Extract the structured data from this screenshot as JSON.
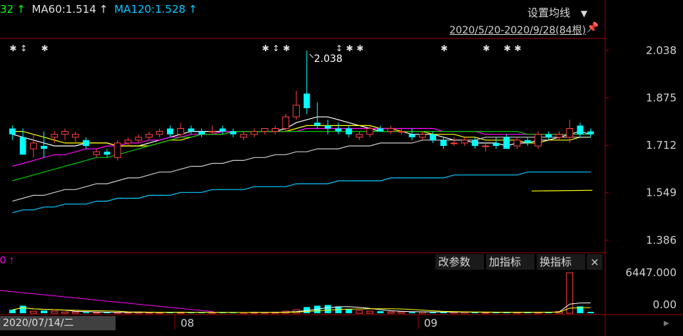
{
  "header": {
    "partial_value": "32",
    "ma60_label": "MA60:1.514",
    "ma120_label": "MA120:1.528",
    "set_ma_button": "设置均线",
    "period": "2020/5/20-2020/9/28(84根)"
  },
  "indicator_panel": {
    "partial_value": "0",
    "buttons": [
      "改参数",
      "加指标",
      "换指标"
    ],
    "close": "×"
  },
  "colors": {
    "up": "#ff4040",
    "down": "#00ffff",
    "ma5": "#ffffff",
    "ma10": "#ffff00",
    "ma20": "#ff00ff",
    "ma30": "#00c800",
    "ma60": "#c8c8c8",
    "ma120": "#00c8ff",
    "axis": "#a00000"
  },
  "chart_data": [
    {
      "type": "candlestick",
      "y_ticks": [
        "2.038",
        "1.875",
        "1.712",
        "1.549",
        "1.386"
      ],
      "ylim": [
        1.35,
        2.07
      ],
      "max_annotation": "2.038",
      "x_ticks": [
        "08",
        "09"
      ],
      "current_date": "2020/07/14/二",
      "candles": [
        {
          "o": 1.77,
          "h": 1.78,
          "l": 1.73,
          "c": 1.75
        },
        {
          "o": 1.74,
          "h": 1.77,
          "l": 1.68,
          "c": 1.68
        },
        {
          "o": 1.7,
          "h": 1.75,
          "l": 1.67,
          "c": 1.72
        },
        {
          "o": 1.71,
          "h": 1.76,
          "l": 1.67,
          "c": 1.7
        },
        {
          "o": 1.74,
          "h": 1.76,
          "l": 1.72,
          "c": 1.75
        },
        {
          "o": 1.75,
          "h": 1.77,
          "l": 1.73,
          "c": 1.76
        },
        {
          "o": 1.74,
          "h": 1.76,
          "l": 1.72,
          "c": 1.75
        },
        {
          "o": 1.73,
          "h": 1.74,
          "l": 1.7,
          "c": 1.71
        },
        {
          "o": 1.68,
          "h": 1.7,
          "l": 1.67,
          "c": 1.69
        },
        {
          "o": 1.69,
          "h": 1.7,
          "l": 1.67,
          "c": 1.68
        },
        {
          "o": 1.67,
          "h": 1.73,
          "l": 1.66,
          "c": 1.72
        },
        {
          "o": 1.72,
          "h": 1.74,
          "l": 1.71,
          "c": 1.73
        },
        {
          "o": 1.73,
          "h": 1.75,
          "l": 1.72,
          "c": 1.74
        },
        {
          "o": 1.74,
          "h": 1.76,
          "l": 1.73,
          "c": 1.75
        },
        {
          "o": 1.75,
          "h": 1.77,
          "l": 1.74,
          "c": 1.76
        },
        {
          "o": 1.77,
          "h": 1.78,
          "l": 1.74,
          "c": 1.75
        },
        {
          "o": 1.75,
          "h": 1.79,
          "l": 1.74,
          "c": 1.77
        },
        {
          "o": 1.77,
          "h": 1.78,
          "l": 1.75,
          "c": 1.76
        },
        {
          "o": 1.76,
          "h": 1.77,
          "l": 1.74,
          "c": 1.75
        },
        {
          "o": 1.76,
          "h": 1.78,
          "l": 1.75,
          "c": 1.76
        },
        {
          "o": 1.77,
          "h": 1.78,
          "l": 1.75,
          "c": 1.76
        },
        {
          "o": 1.76,
          "h": 1.77,
          "l": 1.74,
          "c": 1.75
        },
        {
          "o": 1.74,
          "h": 1.76,
          "l": 1.73,
          "c": 1.75
        },
        {
          "o": 1.75,
          "h": 1.77,
          "l": 1.74,
          "c": 1.76
        },
        {
          "o": 1.76,
          "h": 1.77,
          "l": 1.75,
          "c": 1.77
        },
        {
          "o": 1.76,
          "h": 1.78,
          "l": 1.75,
          "c": 1.77
        },
        {
          "o": 1.77,
          "h": 1.82,
          "l": 1.76,
          "c": 1.81
        },
        {
          "o": 1.81,
          "h": 1.9,
          "l": 1.8,
          "c": 1.85
        },
        {
          "o": 1.89,
          "h": 2.038,
          "l": 1.82,
          "c": 1.84
        },
        {
          "o": 1.79,
          "h": 1.86,
          "l": 1.77,
          "c": 1.78
        },
        {
          "o": 1.78,
          "h": 1.8,
          "l": 1.75,
          "c": 1.77
        },
        {
          "o": 1.77,
          "h": 1.79,
          "l": 1.75,
          "c": 1.76
        },
        {
          "o": 1.77,
          "h": 1.78,
          "l": 1.74,
          "c": 1.75
        },
        {
          "o": 1.74,
          "h": 1.76,
          "l": 1.73,
          "c": 1.75
        },
        {
          "o": 1.75,
          "h": 1.78,
          "l": 1.74,
          "c": 1.77
        },
        {
          "o": 1.77,
          "h": 1.78,
          "l": 1.76,
          "c": 1.76
        },
        {
          "o": 1.76,
          "h": 1.78,
          "l": 1.75,
          "c": 1.77
        },
        {
          "o": 1.76,
          "h": 1.77,
          "l": 1.75,
          "c": 1.76
        },
        {
          "o": 1.75,
          "h": 1.77,
          "l": 1.73,
          "c": 1.74
        },
        {
          "o": 1.74,
          "h": 1.76,
          "l": 1.73,
          "c": 1.75
        },
        {
          "o": 1.75,
          "h": 1.76,
          "l": 1.72,
          "c": 1.73
        },
        {
          "o": 1.73,
          "h": 1.74,
          "l": 1.7,
          "c": 1.71
        },
        {
          "o": 1.72,
          "h": 1.74,
          "l": 1.71,
          "c": 1.72
        },
        {
          "o": 1.72,
          "h": 1.74,
          "l": 1.71,
          "c": 1.73
        },
        {
          "o": 1.73,
          "h": 1.74,
          "l": 1.7,
          "c": 1.71
        },
        {
          "o": 1.71,
          "h": 1.72,
          "l": 1.69,
          "c": 1.71
        },
        {
          "o": 1.72,
          "h": 1.74,
          "l": 1.7,
          "c": 1.71
        },
        {
          "o": 1.74,
          "h": 1.75,
          "l": 1.7,
          "c": 1.7
        },
        {
          "o": 1.71,
          "h": 1.74,
          "l": 1.7,
          "c": 1.73
        },
        {
          "o": 1.73,
          "h": 1.74,
          "l": 1.71,
          "c": 1.72
        },
        {
          "o": 1.71,
          "h": 1.76,
          "l": 1.7,
          "c": 1.75
        },
        {
          "o": 1.75,
          "h": 1.76,
          "l": 1.73,
          "c": 1.74
        },
        {
          "o": 1.74,
          "h": 1.76,
          "l": 1.73,
          "c": 1.75
        },
        {
          "o": 1.74,
          "h": 1.8,
          "l": 1.72,
          "c": 1.77
        },
        {
          "o": 1.78,
          "h": 1.79,
          "l": 1.74,
          "c": 1.75
        },
        {
          "o": 1.76,
          "h": 1.77,
          "l": 1.74,
          "c": 1.75
        }
      ],
      "ma_lines": [
        {
          "name": "MA5",
          "values": [
            1.75,
            1.74,
            1.73,
            1.72,
            1.71,
            1.71,
            1.71,
            1.72,
            1.72,
            1.72,
            1.71,
            1.71,
            1.71,
            1.72,
            1.73,
            1.74,
            1.75,
            1.76,
            1.76,
            1.76,
            1.76,
            1.76,
            1.76,
            1.76,
            1.76,
            1.76,
            1.77,
            1.79,
            1.8,
            1.81,
            1.81,
            1.8,
            1.79,
            1.78,
            1.77,
            1.76,
            1.76,
            1.76,
            1.75,
            1.75,
            1.75,
            1.74,
            1.73,
            1.73,
            1.72,
            1.72,
            1.72,
            1.71,
            1.72,
            1.72,
            1.73,
            1.73,
            1.74,
            1.75,
            1.76,
            1.75
          ]
        },
        {
          "name": "MA10",
          "values": [
            1.76,
            1.76,
            1.75,
            1.74,
            1.73,
            1.72,
            1.72,
            1.72,
            1.72,
            1.72,
            1.71,
            1.71,
            1.71,
            1.71,
            1.72,
            1.73,
            1.73,
            1.74,
            1.75,
            1.75,
            1.75,
            1.76,
            1.76,
            1.76,
            1.76,
            1.76,
            1.76,
            1.77,
            1.78,
            1.78,
            1.78,
            1.78,
            1.78,
            1.78,
            1.78,
            1.77,
            1.77,
            1.76,
            1.76,
            1.76,
            1.75,
            1.75,
            1.75,
            1.74,
            1.74,
            1.73,
            1.73,
            1.73,
            1.73,
            1.72,
            1.72,
            1.73,
            1.73,
            1.73,
            1.74,
            1.74
          ]
        },
        {
          "name": "MA20",
          "values": [
            1.64,
            1.65,
            1.66,
            1.67,
            1.68,
            1.68,
            1.69,
            1.7,
            1.7,
            1.71,
            1.71,
            1.72,
            1.72,
            1.73,
            1.73,
            1.74,
            1.74,
            1.75,
            1.75,
            1.75,
            1.76,
            1.76,
            1.76,
            1.76,
            1.76,
            1.76,
            1.76,
            1.76,
            1.77,
            1.77,
            1.77,
            1.77,
            1.77,
            1.77,
            1.77,
            1.77,
            1.77,
            1.77,
            1.77,
            1.77,
            1.77,
            1.76,
            1.76,
            1.76,
            1.76,
            1.75,
            1.75,
            1.75,
            1.75,
            1.75,
            1.75,
            1.75,
            1.75,
            1.75,
            1.75,
            1.75
          ]
        },
        {
          "name": "MA30",
          "values": [
            1.59,
            1.6,
            1.61,
            1.62,
            1.63,
            1.64,
            1.65,
            1.66,
            1.67,
            1.67,
            1.68,
            1.69,
            1.7,
            1.71,
            1.72,
            1.73,
            1.74,
            1.74,
            1.75,
            1.75,
            1.75,
            1.76,
            1.76,
            1.76,
            1.76,
            1.76,
            1.76,
            1.76,
            1.76,
            1.76,
            1.76,
            1.76,
            1.76,
            1.76,
            1.76,
            1.76,
            1.76,
            1.76,
            1.76,
            1.76,
            1.76,
            1.76,
            1.76,
            1.76,
            1.76,
            1.76,
            1.76,
            1.76,
            1.76,
            1.75,
            1.75,
            1.75,
            1.75,
            1.75,
            1.75,
            1.75
          ]
        },
        {
          "name": "MA60",
          "values": [
            1.52,
            1.53,
            1.54,
            1.54,
            1.55,
            1.56,
            1.56,
            1.57,
            1.58,
            1.58,
            1.59,
            1.6,
            1.6,
            1.61,
            1.62,
            1.62,
            1.63,
            1.64,
            1.64,
            1.65,
            1.65,
            1.66,
            1.66,
            1.67,
            1.67,
            1.68,
            1.68,
            1.69,
            1.69,
            1.7,
            1.7,
            1.7,
            1.71,
            1.71,
            1.71,
            1.72,
            1.72,
            1.72,
            1.72,
            1.73,
            1.73,
            1.73,
            1.73,
            1.73,
            1.73,
            1.74,
            1.74,
            1.74,
            1.74,
            1.74,
            1.74,
            1.74,
            1.74,
            1.74,
            1.74,
            1.74
          ]
        },
        {
          "name": "MA120",
          "values": [
            1.48,
            1.49,
            1.49,
            1.5,
            1.5,
            1.51,
            1.51,
            1.51,
            1.52,
            1.52,
            1.53,
            1.53,
            1.53,
            1.54,
            1.54,
            1.54,
            1.55,
            1.55,
            1.55,
            1.56,
            1.56,
            1.56,
            1.56,
            1.57,
            1.57,
            1.57,
            1.57,
            1.58,
            1.58,
            1.58,
            1.58,
            1.59,
            1.59,
            1.59,
            1.59,
            1.59,
            1.6,
            1.6,
            1.6,
            1.6,
            1.6,
            1.6,
            1.61,
            1.61,
            1.61,
            1.61,
            1.61,
            1.61,
            1.61,
            1.62,
            1.62,
            1.62,
            1.62,
            1.62,
            1.62,
            1.62
          ]
        }
      ]
    },
    {
      "type": "bar",
      "name": "volume",
      "y_ticks": [
        "6447.000",
        "0.00"
      ],
      "ylim": [
        0,
        6447
      ],
      "values": [
        500,
        1100,
        300,
        400,
        300,
        200,
        200,
        150,
        100,
        150,
        100,
        100,
        150,
        100,
        100,
        100,
        150,
        100,
        100,
        100,
        100,
        100,
        100,
        150,
        100,
        150,
        300,
        500,
        900,
        1100,
        1200,
        1000,
        600,
        400,
        300,
        300,
        200,
        200,
        150,
        200,
        150,
        200,
        150,
        150,
        150,
        100,
        150,
        100,
        150,
        150,
        150,
        200,
        250,
        5900,
        1000,
        200
      ]
    }
  ]
}
